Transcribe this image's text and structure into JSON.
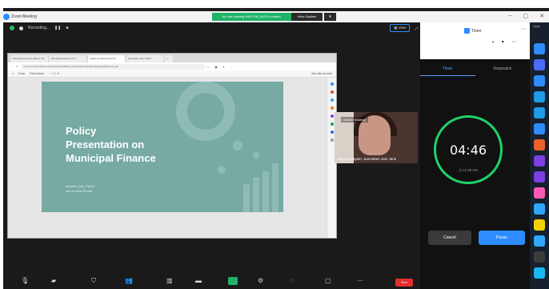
{
  "window": {
    "title": "Zoom Meeting",
    "controls": [
      "–",
      "▢",
      "✕"
    ]
  },
  "notice": {
    "text": "You are viewing WRD PM_WOC's screen",
    "button": "View Options",
    "close": "▾"
  },
  "meeting": {
    "status": "Recording...",
    "view_label": "View",
    "view_icon": "grid-icon"
  },
  "browser": {
    "tabs": [
      "Municipal Finance eBook | Se",
      "Municipal Finance Con",
      "Adobe Acrobat Documen",
      "Sarvottam Jain Public",
      "+"
    ],
    "url": "C:/Users/Admin/Documents/Policy%20Presentation%20on%20Municipal%20Finance.pdf",
    "pdf_toolbar": [
      "Draw",
      "Read aloud",
      "Ask with Acrobat"
    ]
  },
  "slide": {
    "title_lines": [
      "Policy",
      "Presentation on",
      "Municipal Finance"
    ],
    "subtitle_lines": [
      "samrthh_jain_Patna",
      "sarna Holla Tender"
    ]
  },
  "participant": {
    "name": "Sandya Nayam, Sarvottam Jain Jaris",
    "badge": "Screen Sharing"
  },
  "toolbar": {
    "end": "End"
  },
  "timer": {
    "app_name": "Timer",
    "tabs": [
      "Timer",
      "Stopwatch"
    ],
    "time": "04:46",
    "clock": "11:38 AM",
    "cancel": "Cancel",
    "pause": "Pause"
  },
  "apps": {
    "label": "Apps",
    "tile_colors": [
      "#2d8cff",
      "#4b6bff",
      "#2d8cff",
      "#1e9be9",
      "#e8622c",
      "#7b3fe4",
      "#ff5ab3",
      "#f2d200",
      "#2fa7ff",
      "#3c3c3c",
      "#18b8f0"
    ]
  },
  "colors": {
    "slide_bg": "#76aaa3",
    "timer_ring": "#1ed36b",
    "accent": "#2d8cff",
    "end_button": "#e02f2f"
  }
}
